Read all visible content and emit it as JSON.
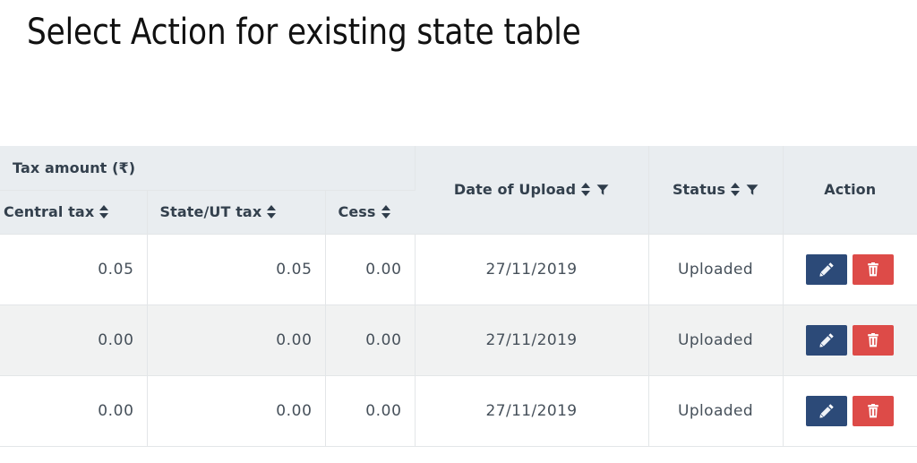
{
  "page": {
    "title": "Select Action for existing state table"
  },
  "table": {
    "group_header": {
      "label": "Tax amount (₹)"
    },
    "columns": [
      {
        "key": "central_tax",
        "label": "Central tax",
        "sortable": true,
        "filterable": false,
        "align": "right"
      },
      {
        "key": "state_ut_tax",
        "label": "State/UT tax",
        "sortable": true,
        "filterable": false,
        "align": "right"
      },
      {
        "key": "cess",
        "label": "Cess",
        "sortable": true,
        "filterable": false,
        "align": "right"
      },
      {
        "key": "date_of_upload",
        "label": "Date of Upload",
        "sortable": true,
        "filterable": true,
        "align": "center"
      },
      {
        "key": "status",
        "label": "Status",
        "sortable": true,
        "filterable": true,
        "align": "center"
      },
      {
        "key": "action",
        "label": "Action",
        "sortable": false,
        "filterable": false,
        "align": "center"
      }
    ],
    "rows": [
      {
        "central_tax": "0.05",
        "state_ut_tax": "0.05",
        "cess": "0.00",
        "date_of_upload": "27/11/2019",
        "status": "Uploaded",
        "striped": false
      },
      {
        "central_tax": "0.00",
        "state_ut_tax": "0.00",
        "cess": "0.00",
        "date_of_upload": "27/11/2019",
        "status": "Uploaded",
        "striped": true
      },
      {
        "central_tax": "0.00",
        "state_ut_tax": "0.00",
        "cess": "0.00",
        "date_of_upload": "27/11/2019",
        "status": "Uploaded",
        "striped": false
      }
    ],
    "action_buttons": {
      "edit": {
        "icon": "pencil-icon",
        "title": "Edit"
      },
      "delete": {
        "icon": "trash-icon",
        "title": "Delete"
      }
    },
    "icons": {
      "sort": "sort-icon",
      "filter": "filter-icon"
    }
  },
  "colors": {
    "header_background": "#e9edf0",
    "header_text": "#33404d",
    "row_stripe": "#f1f2f2",
    "cell_text": "#46505a",
    "border": "#e3e6e8",
    "edit_button": "#2c4a78",
    "delete_button": "#dd4b48"
  }
}
